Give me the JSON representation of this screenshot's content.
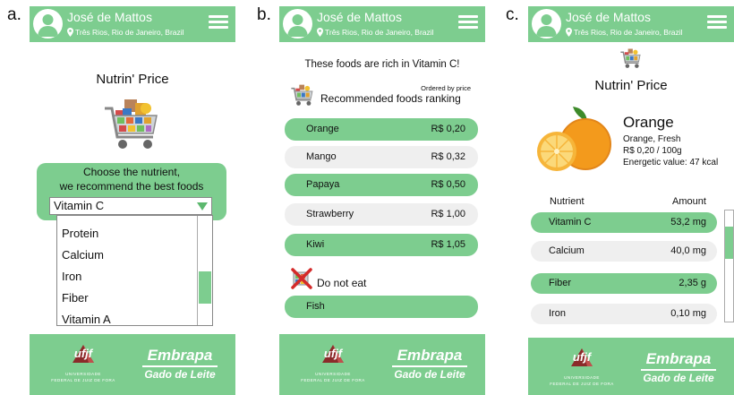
{
  "panel_labels": [
    "a.",
    "b.",
    "c."
  ],
  "header": {
    "user_name": "José de Mattos",
    "location": "Três Rios, Rio de Janeiro, Brazil"
  },
  "footer": {
    "ufjf_logo_text": "ufjf",
    "ufjf_sub1": "UNIVERSIDADE",
    "ufjf_sub2": "FEDERAL DE JUIZ DE FORA",
    "embrapa_name": "Embrapa",
    "embrapa_sub": "Gado de Leite"
  },
  "panel_a": {
    "app_title": "Nutrin' Price",
    "choose_line1": "Choose the nutrient,",
    "choose_line2": "we recommend the best foods",
    "selected": "Vitamin C",
    "options": [
      "Protein",
      "Calcium",
      "Iron",
      "Fiber",
      "Vitamin A"
    ]
  },
  "panel_b": {
    "rich_title": "These foods are rich in Vitamin C!",
    "ordered_by": "Ordered by price",
    "ranking_title": "Recommended foods ranking",
    "foods": [
      {
        "name": "Orange",
        "price": "R$ 0,20",
        "style": "green"
      },
      {
        "name": "Mango",
        "price": "R$ 0,32",
        "style": "gray"
      },
      {
        "name": "Papaya",
        "price": "R$ 0,50",
        "style": "green"
      },
      {
        "name": "Strawberry",
        "price": "R$ 1,00",
        "style": "gray"
      },
      {
        "name": "Kiwi",
        "price": "R$ 1,05",
        "style": "green"
      }
    ],
    "do_not_eat": "Do not eat",
    "avoid_foods": [
      {
        "name": "Fish",
        "style": "green"
      }
    ]
  },
  "panel_c": {
    "app_title": "Nutrin' Price",
    "food_name": "Orange",
    "food_variant": "Orange, Fresh",
    "food_price": "R$ 0,20 / 100g",
    "energetic": "Energetic value: 47 kcal",
    "col_nutrient": "Nutrient",
    "col_amount": "Amount",
    "nutrients": [
      {
        "name": "Vitamin C",
        "amount": "53,2 mg",
        "style": "green"
      },
      {
        "name": "Calcium",
        "amount": "40,0 mg",
        "style": "gray"
      },
      {
        "name": "Fiber",
        "amount": "2,35 g",
        "style": "green"
      },
      {
        "name": "Iron",
        "amount": "0,10 mg",
        "style": "gray"
      }
    ]
  },
  "colors": {
    "accent": "#7dcd8f",
    "row_gray": "#efefef",
    "arrow": "#5cb86e"
  },
  "icons": [
    "user-avatar-icon",
    "location-pin-icon",
    "hamburger-menu-icon",
    "shopping-cart-icon",
    "no-food-icon"
  ]
}
